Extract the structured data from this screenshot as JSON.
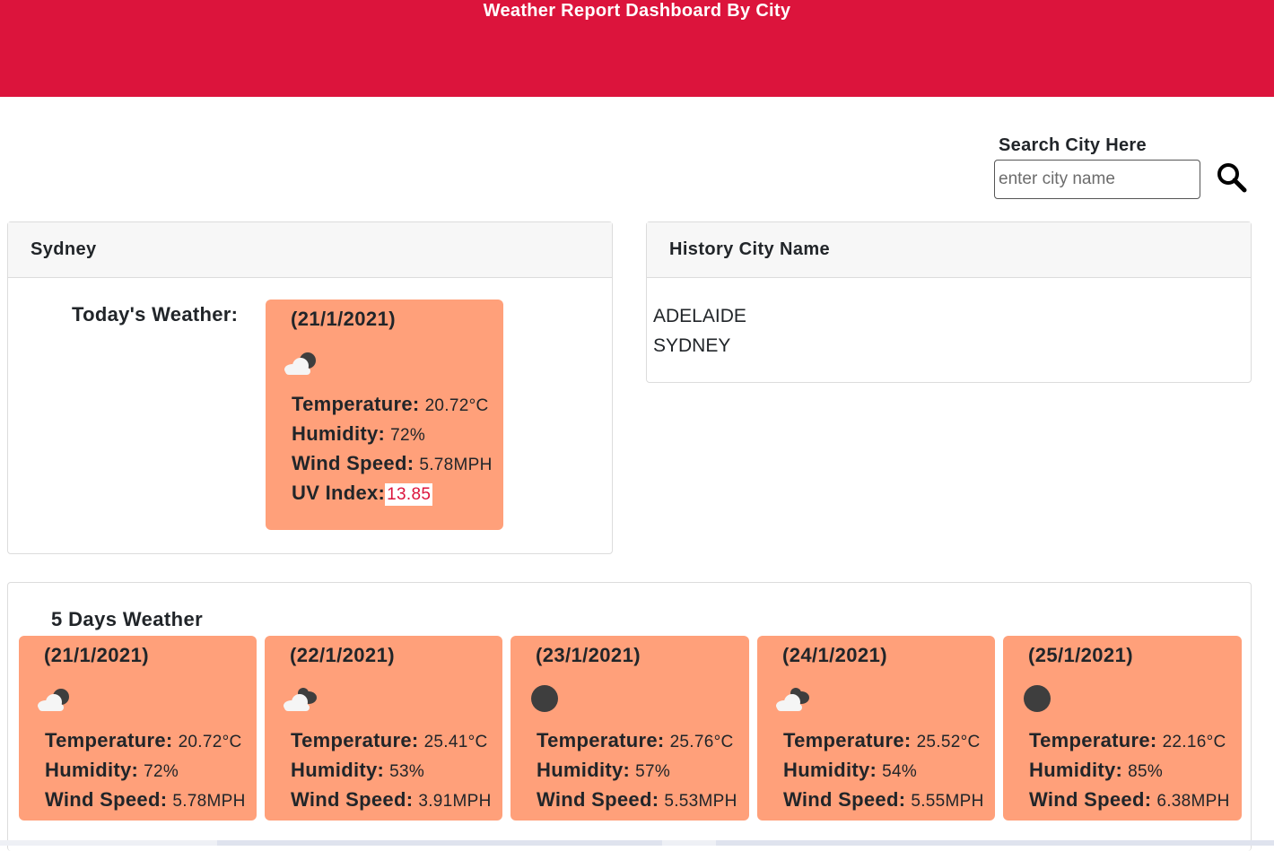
{
  "header": {
    "title": "Weather Report Dashboard By City"
  },
  "search": {
    "label": "Search City Here",
    "placeholder": "enter city name",
    "value": "",
    "button_icon": "search-icon"
  },
  "current": {
    "city": "Sydney",
    "today_label": "Today's Weather:",
    "date": "(21/1/2021)",
    "icon": "cloud-night-icon",
    "temperature_label": "Temperature:",
    "temperature": "20.72°C",
    "humidity_label": "Humidity:",
    "humidity": "72%",
    "wind_label": "Wind Speed:",
    "wind": "5.78MPH",
    "uv_label": "UV Index:",
    "uv": "13.85"
  },
  "history": {
    "title": "History City Name",
    "items": [
      "ADELAIDE",
      "SYDNEY"
    ]
  },
  "forecast": {
    "title": "5 Days Weather",
    "labels": {
      "temperature": "Temperature:",
      "humidity": "Humidity:",
      "wind": "Wind Speed:"
    },
    "days": [
      {
        "date": "(21/1/2021)",
        "icon": "cloud-night-icon",
        "temperature": "20.72°C",
        "humidity": "72%",
        "wind": "5.78MPH"
      },
      {
        "date": "(22/1/2021)",
        "icon": "broken-clouds-icon",
        "temperature": "25.41°C",
        "humidity": "53%",
        "wind": "3.91MPH"
      },
      {
        "date": "(23/1/2021)",
        "icon": "clear-night-icon",
        "temperature": "25.76°C",
        "humidity": "57%",
        "wind": "5.53MPH"
      },
      {
        "date": "(24/1/2021)",
        "icon": "broken-clouds-icon",
        "temperature": "25.52°C",
        "humidity": "54%",
        "wind": "5.55MPH"
      },
      {
        "date": "(25/1/2021)",
        "icon": "clear-night-icon",
        "temperature": "22.16°C",
        "humidity": "85%",
        "wind": "6.38MPH"
      }
    ]
  },
  "colors": {
    "header_bg": "#dc143c",
    "card_bg": "#ffa07a",
    "uv_text": "#dc143c"
  }
}
